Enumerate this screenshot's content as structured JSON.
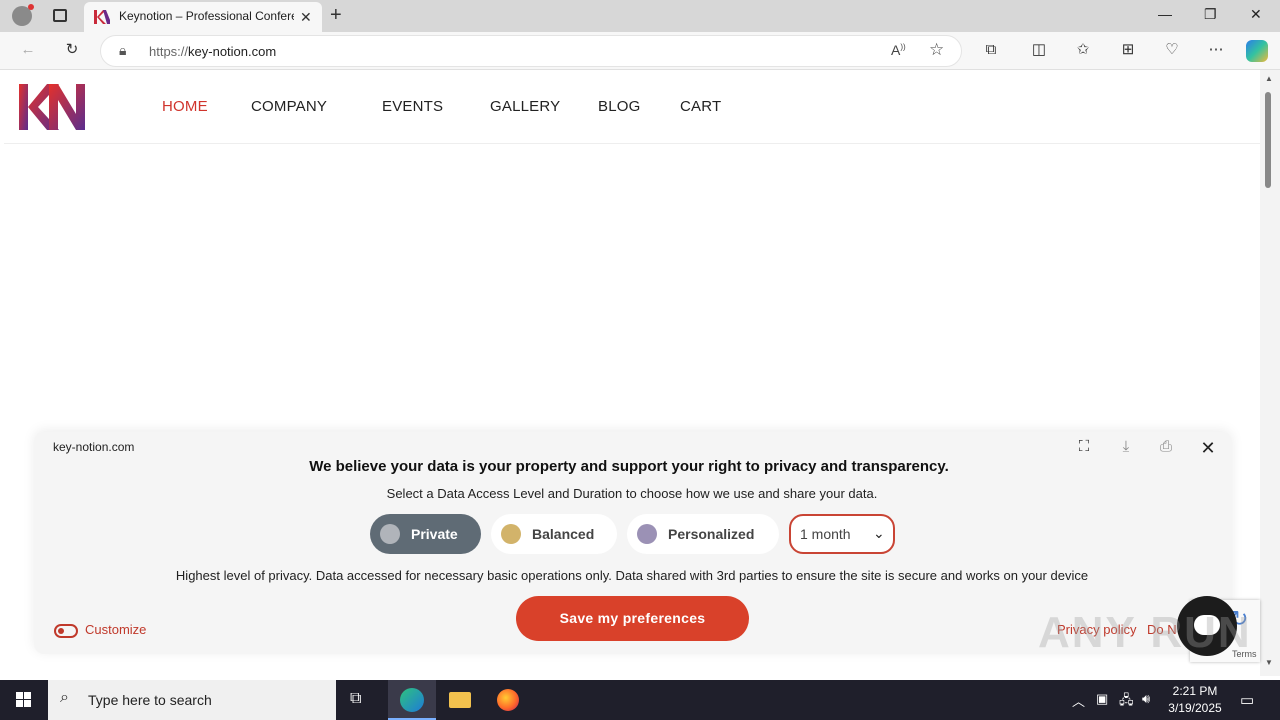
{
  "browser": {
    "tab_title": "Keynotion – Professional Confere",
    "url_scheme": "https://",
    "url_host": "key-notion.com"
  },
  "site": {
    "nav": [
      "HOME",
      "COMPANY",
      "EVENTS",
      "GALLERY",
      "BLOG",
      "CART"
    ]
  },
  "consent": {
    "domain": "key-notion.com",
    "headline": "We believe your data is your property and support your right to privacy and transparency.",
    "subheadline": "Select a Data Access Level and Duration to choose how we use and share your data.",
    "levels": [
      {
        "label": "Private",
        "color": "#b0b4ba"
      },
      {
        "label": "Balanced",
        "color": "#d2b36a"
      },
      {
        "label": "Personalized",
        "color": "#9b91b5"
      }
    ],
    "selected_level": "Private",
    "duration": "1 month",
    "description": "Highest level of privacy. Data accessed for necessary basic operations only. Data shared with 3rd parties to ensure the site is secure and works on your device",
    "save_label": "Save my preferences",
    "customize_label": "Customize",
    "privacy_link": "Privacy policy",
    "donot_link": "Do N"
  },
  "recaptcha": {
    "terms": "Terms"
  },
  "watermark": "ANY RUN",
  "taskbar": {
    "search_placeholder": "Type here to search",
    "time": "2:21 PM",
    "date": "3/19/2025"
  },
  "colors": {
    "accent": "#d9412a",
    "nav_active": "#d0342c"
  }
}
